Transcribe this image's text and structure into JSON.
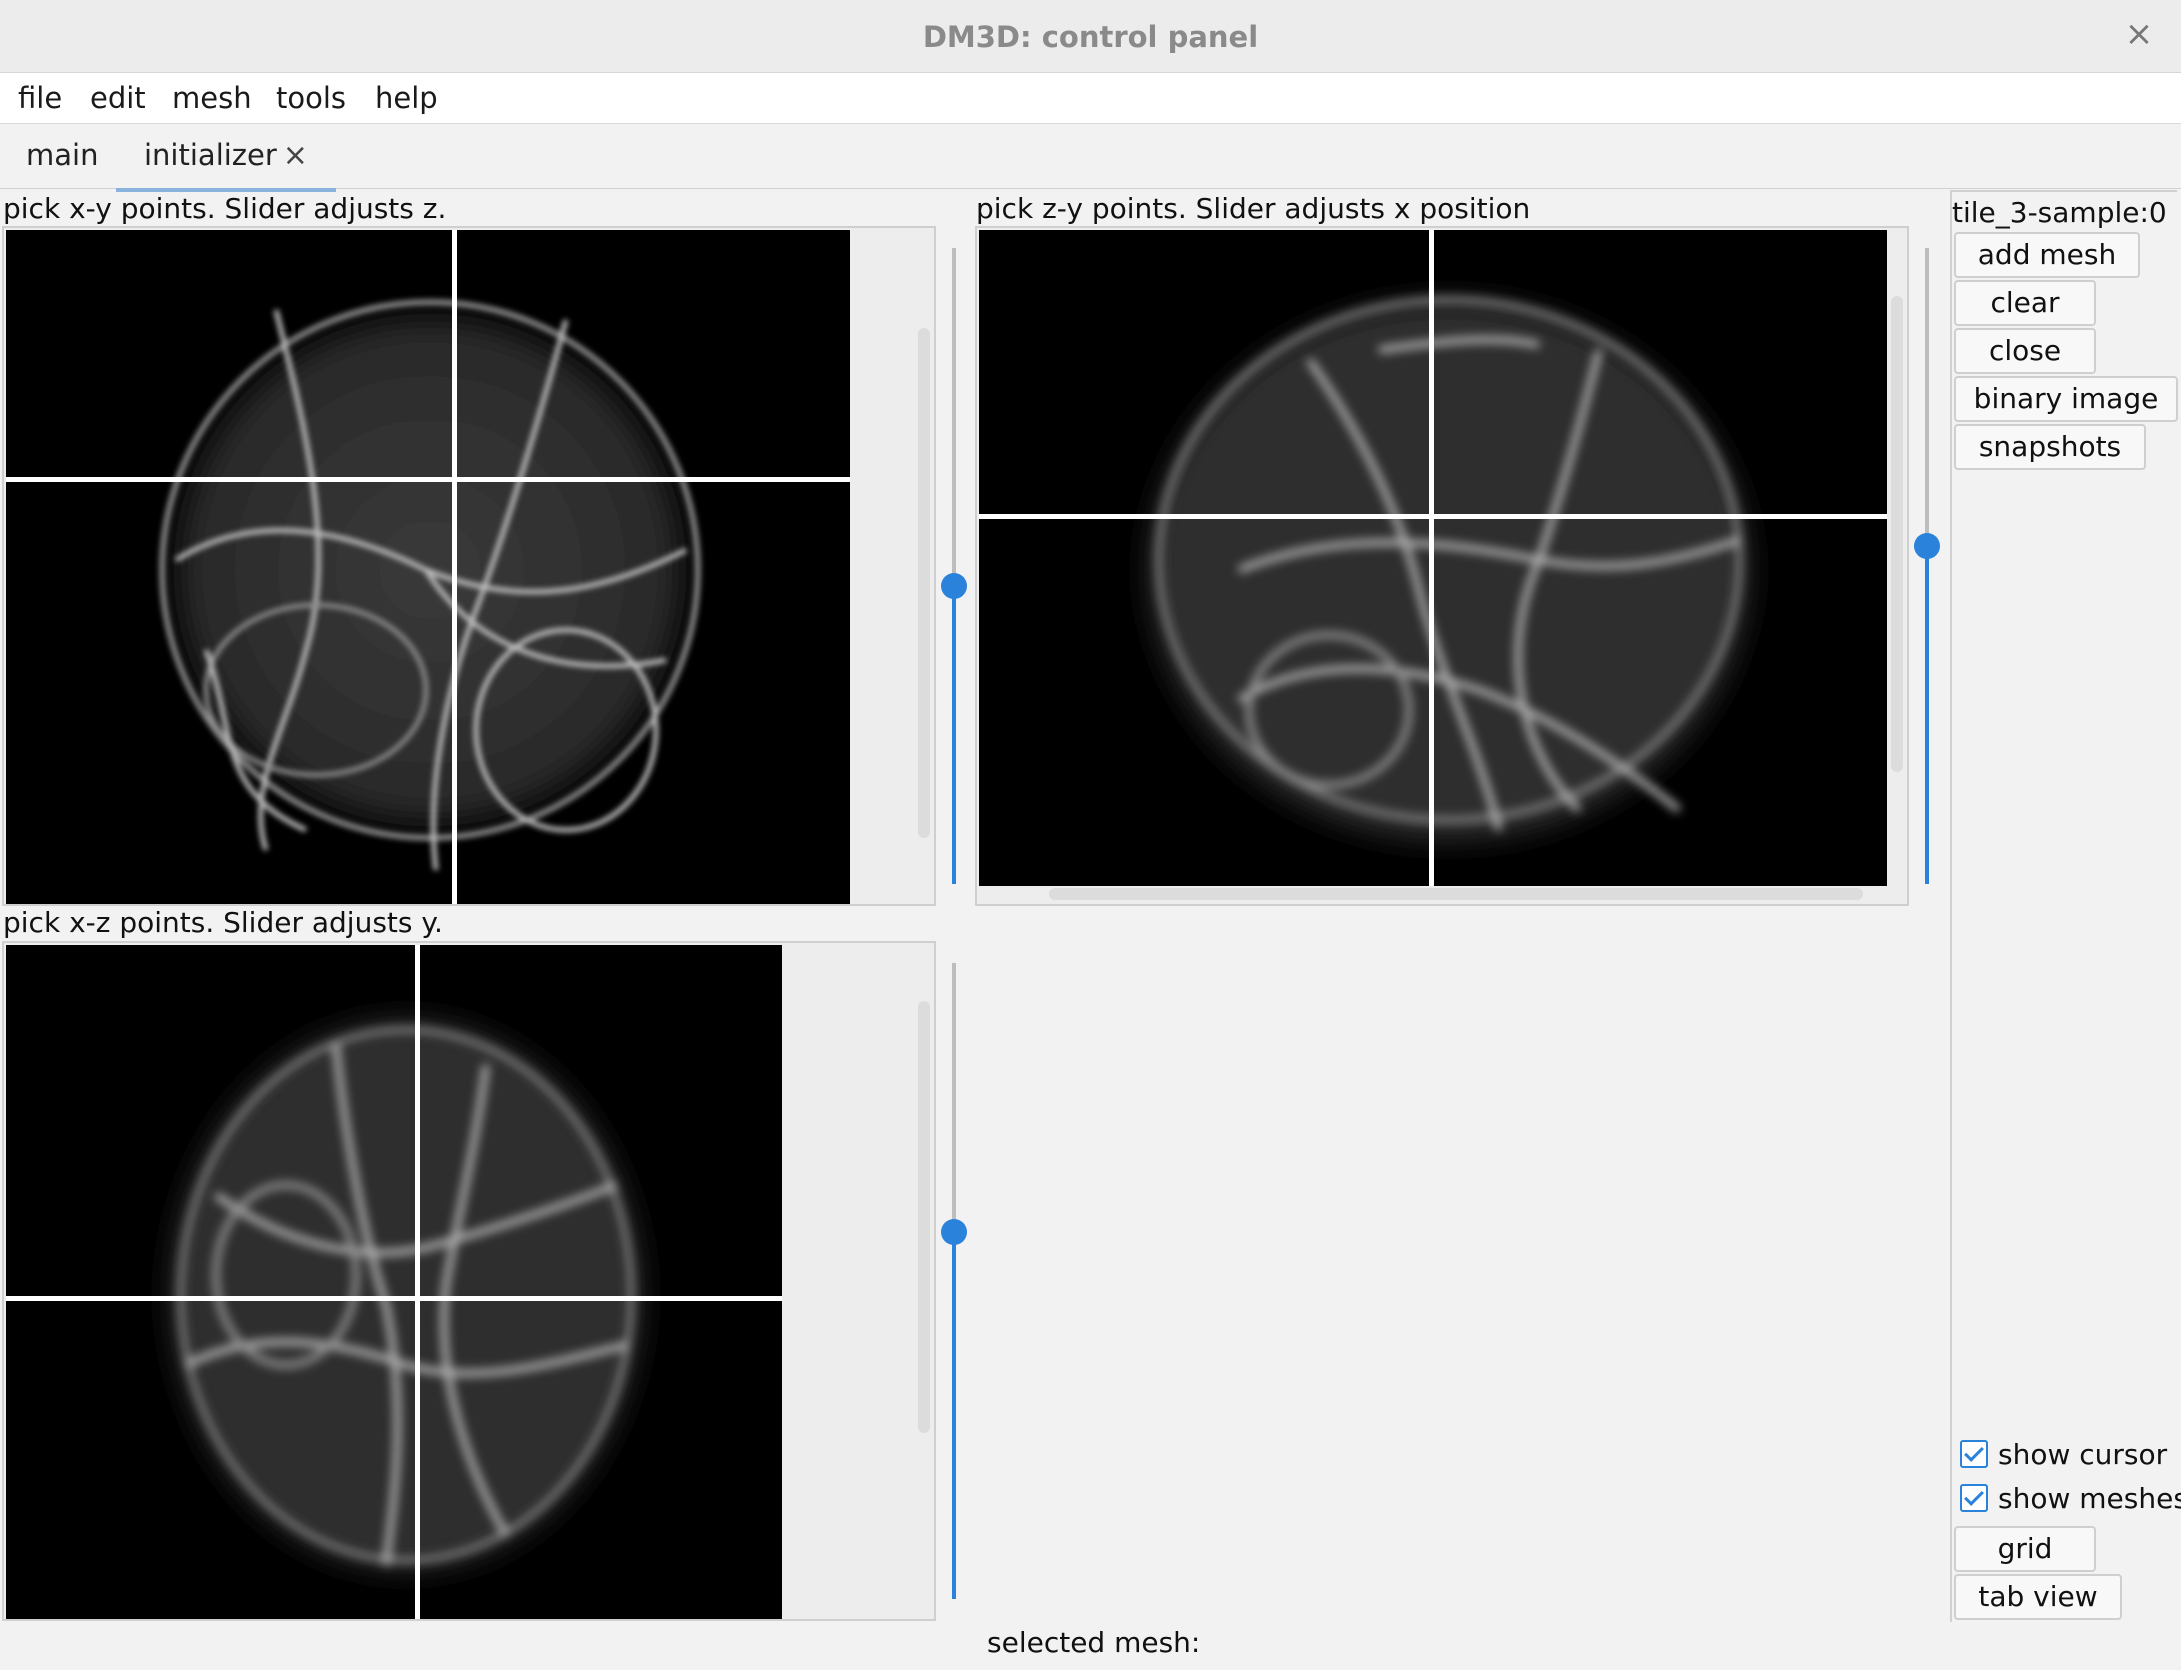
{
  "window": {
    "title": "DM3D: control panel",
    "close_glyph": "×"
  },
  "menu": [
    "file",
    "edit",
    "mesh",
    "tools",
    "help"
  ],
  "tabs": [
    {
      "label": "main",
      "active": false
    },
    {
      "label": "initializer",
      "active": true,
      "close_glyph": "×"
    }
  ],
  "panels": {
    "xy": {
      "label": "pick x-y points. Slider adjusts z.",
      "slider_value": 0.47
    },
    "zy": {
      "label": "pick z-y points. Slider adjusts x position",
      "slider_value": 0.47
    },
    "xz": {
      "label": "pick x-z points. Slider adjusts y.",
      "slider_value": 0.58
    }
  },
  "sidebar": {
    "dataset_label": "tile_3-sample:0",
    "buttons": [
      "add mesh",
      "clear",
      "close",
      "binary image",
      "snapshots"
    ],
    "checkboxes": [
      {
        "label": "show cursor",
        "checked": true
      },
      {
        "label": "show meshes",
        "checked": true
      }
    ],
    "bottom_buttons": [
      "grid",
      "tab view"
    ]
  },
  "status": {
    "selected_mesh": "selected mesh:"
  },
  "colors": {
    "accent": "#2a82da",
    "tab_underline": "#89b3dd",
    "image_bg": "#000000"
  }
}
